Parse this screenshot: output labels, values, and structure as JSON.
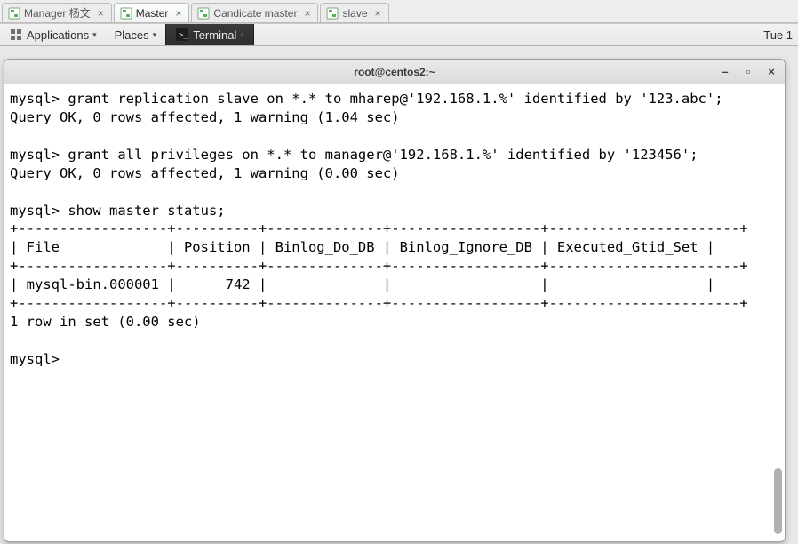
{
  "editor_tabs": [
    {
      "label": "Manager 杨文",
      "active": false
    },
    {
      "label": "Master",
      "active": true
    },
    {
      "label": "Candicate master",
      "active": false
    },
    {
      "label": "slave",
      "active": false
    }
  ],
  "panel": {
    "applications": "Applications",
    "places": "Places",
    "terminal": "Terminal",
    "clock": "Tue 1"
  },
  "terminal": {
    "title": "root@centos2:~",
    "content": "mysql> grant replication slave on *.* to mharep@'192.168.1.%' identified by '123.abc';\nQuery OK, 0 rows affected, 1 warning (1.04 sec)\n\nmysql> grant all privileges on *.* to manager@'192.168.1.%' identified by '123456';\nQuery OK, 0 rows affected, 1 warning (0.00 sec)\n\nmysql> show master status;\n+------------------+----------+--------------+------------------+-----------------------+\n| File             | Position | Binlog_Do_DB | Binlog_Ignore_DB | Executed_Gtid_Set |\n+------------------+----------+--------------+------------------+-----------------------+\n| mysql-bin.000001 |      742 |              |                  |                   |\n+------------------+----------+--------------+------------------+-----------------------+\n1 row in set (0.00 sec)\n\nmysql> "
  },
  "chart_data": {
    "type": "table",
    "title": "show master status",
    "columns": [
      "File",
      "Position",
      "Binlog_Do_DB",
      "Binlog_Ignore_DB",
      "Executed_Gtid_Set"
    ],
    "rows": [
      [
        "mysql-bin.000001",
        742,
        "",
        "",
        ""
      ]
    ],
    "row_count": 1,
    "elapsed_sec": 0.0
  }
}
